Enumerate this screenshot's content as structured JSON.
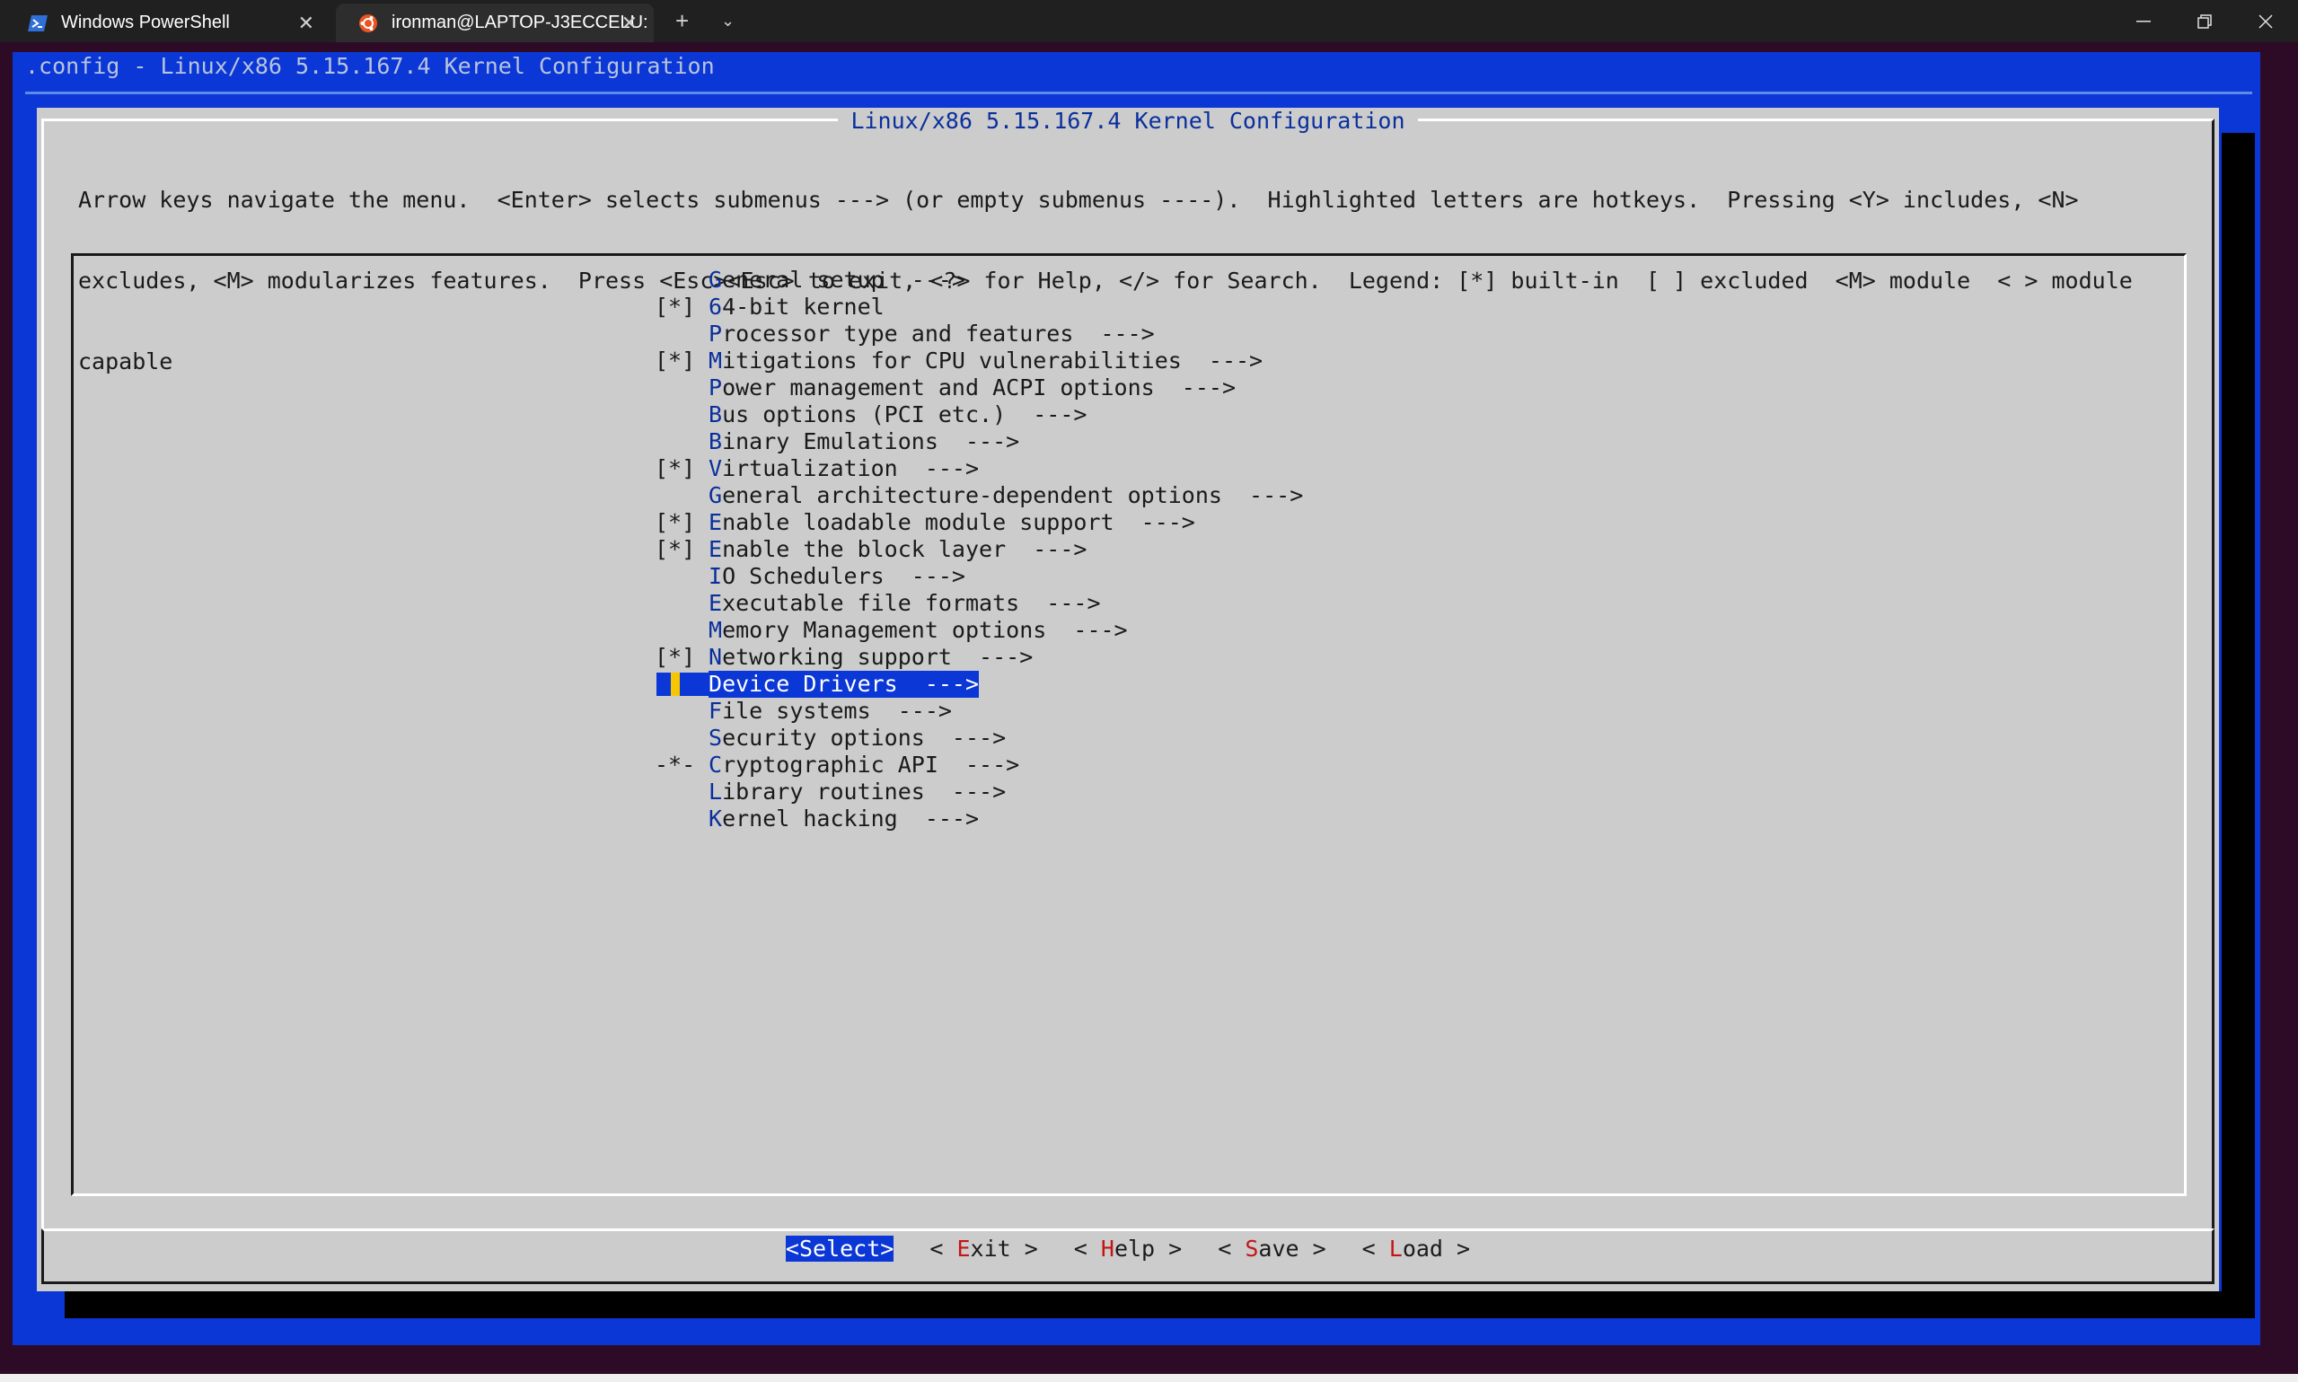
{
  "tabs": [
    {
      "title": "Windows PowerShell",
      "icon": "powershell-icon",
      "active": false
    },
    {
      "title": "ironman@LAPTOP-J3ECCELU:",
      "icon": "ubuntu-icon",
      "active": true
    }
  ],
  "terminal": {
    "top_title": ".config - Linux/x86 5.15.167.4 Kernel Configuration",
    "dialog_title": "Linux/x86 5.15.167.4 Kernel Configuration",
    "help_lines": [
      "Arrow keys navigate the menu.  <Enter> selects submenus ---> (or empty submenus ----).  Highlighted letters are hotkeys.  Pressing <Y> includes, <N>",
      "excludes, <M> modularizes features.  Press <Esc><Esc> to exit, <?> for Help, </> for Search.  Legend: [*] built-in  [ ] excluded  <M> module  < > module",
      "capable"
    ],
    "menu_items": [
      {
        "prefix": "   ",
        "hot": "G",
        "rest": "eneral setup  --->"
      },
      {
        "prefix": "[*]",
        "hot": "6",
        "rest": "4-bit kernel"
      },
      {
        "prefix": "   ",
        "hot": "P",
        "rest": "rocessor type and features  --->"
      },
      {
        "prefix": "[*]",
        "hot": "M",
        "rest": "itigations for CPU vulnerabilities  --->"
      },
      {
        "prefix": "   ",
        "hot": "P",
        "rest": "ower management and ACPI options  --->"
      },
      {
        "prefix": "   ",
        "hot": "B",
        "rest": "us options (PCI etc.)  --->"
      },
      {
        "prefix": "   ",
        "hot": "B",
        "rest": "inary Emulations  --->"
      },
      {
        "prefix": "[*]",
        "hot": "V",
        "rest": "irtualization  --->"
      },
      {
        "prefix": "   ",
        "hot": "G",
        "rest": "eneral architecture-dependent options  --->"
      },
      {
        "prefix": "[*]",
        "hot": "E",
        "rest": "nable loadable module support  --->"
      },
      {
        "prefix": "[*]",
        "hot": "E",
        "rest": "nable the block layer  --->"
      },
      {
        "prefix": "   ",
        "hot": "I",
        "rest": "O Schedulers  --->"
      },
      {
        "prefix": "   ",
        "hot": "E",
        "rest": "xecutable file formats  --->"
      },
      {
        "prefix": "   ",
        "hot": "M",
        "rest": "emory Management options  --->"
      },
      {
        "prefix": "[*]",
        "hot": "N",
        "rest": "etworking support  --->"
      },
      {
        "prefix": "",
        "hot": "D",
        "rest": "evice Drivers  --->",
        "selected": true
      },
      {
        "prefix": "   ",
        "hot": "F",
        "rest": "ile systems  --->"
      },
      {
        "prefix": "   ",
        "hot": "S",
        "rest": "ecurity options  --->"
      },
      {
        "prefix": "-*-",
        "hot": "C",
        "rest": "ryptographic API  --->"
      },
      {
        "prefix": "   ",
        "hot": "L",
        "rest": "ibrary routines  --->"
      },
      {
        "prefix": "   ",
        "hot": "K",
        "rest": "ernel hacking  --->"
      }
    ],
    "buttons": [
      {
        "left": "<",
        "hot": "S",
        "rest": "elect",
        "right": ">",
        "active": true
      },
      {
        "left": "< ",
        "hot": "E",
        "rest": "xit",
        "right": " >",
        "active": false
      },
      {
        "left": "< ",
        "hot": "H",
        "rest": "elp",
        "right": " >",
        "active": false
      },
      {
        "left": "< ",
        "hot": "S",
        "rest": "ave",
        "right": " >",
        "active": false
      },
      {
        "left": "< ",
        "hot": "L",
        "rest": "oad",
        "right": " >",
        "active": false
      }
    ]
  },
  "colors": {
    "terminal_blue": "#0a37d6",
    "hotkey_blue": "#0a2f9c",
    "hotkey_red": "#c41414",
    "dialog_gray": "#cccccc",
    "cursor_yellow": "#f7c600"
  }
}
